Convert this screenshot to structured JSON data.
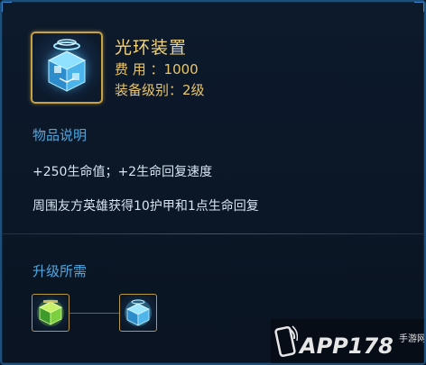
{
  "item": {
    "name": "光环装置",
    "cost_label": "费 用 ：",
    "cost_value": "1000",
    "level_label": "装备级别：",
    "level_value": "2级",
    "icon": "glowing-blue-cube-icon",
    "frame_color": "#c7a243"
  },
  "description": {
    "title": "物品说明",
    "lines": [
      "+250生命值；+2生命回复速度",
      "周围友方英雄获得10护甲和1点生命回复"
    ]
  },
  "upgrade": {
    "title": "升级所需",
    "components": [
      {
        "icon": "green-crystal-cube-icon"
      },
      {
        "icon": "blue-crystal-cube-icon"
      }
    ]
  },
  "watermark": {
    "brand": "APP178",
    "tagline": "手游网",
    "icon": "phone-icon"
  },
  "colors": {
    "accent_gold": "#f2d27a",
    "section_blue": "#4fa7e0",
    "text": "#d7e4f2",
    "border": "#1c4f7c"
  }
}
